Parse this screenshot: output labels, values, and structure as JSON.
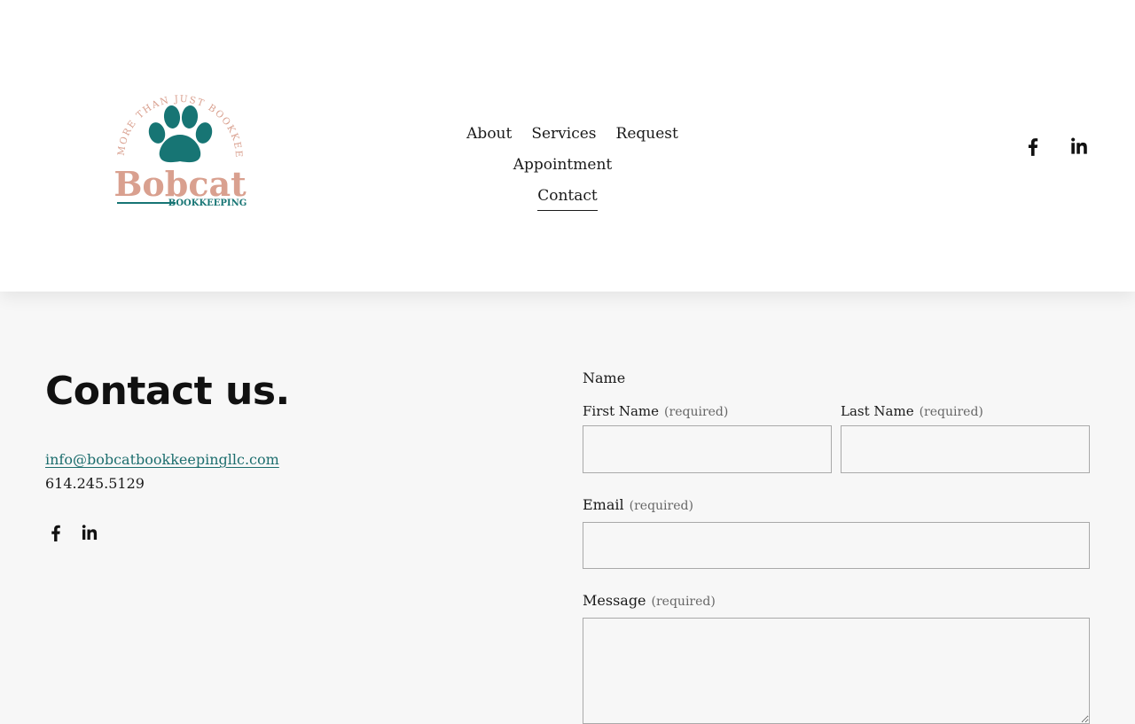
{
  "logo": {
    "arc_text": "MORE THAN JUST BOOKKEEPING",
    "brand": "Bobcat",
    "subtitle": "BOOKKEEPING",
    "paw_color": "#177574",
    "brand_color": "#d9a08f"
  },
  "nav": {
    "items": [
      {
        "label": "About"
      },
      {
        "label": "Services"
      },
      {
        "label": "Request Appointment"
      },
      {
        "label": "Contact",
        "active": true
      }
    ]
  },
  "header_social": [
    "facebook-icon",
    "linkedin-icon"
  ],
  "contact": {
    "title": "Contact us.",
    "email": "info@bobcatbookkeepingllc.com",
    "phone": "614.245.5129",
    "social": [
      "facebook-icon",
      "linkedin-icon"
    ]
  },
  "form": {
    "name_label": "Name",
    "first_name_label": "First Name",
    "last_name_label": "Last Name",
    "email_label": "Email",
    "message_label": "Message",
    "required_text": "(required)",
    "first_name_value": "",
    "last_name_value": "",
    "email_value": "",
    "message_value": ""
  },
  "colors": {
    "accent_link": "#1d6e6e",
    "page_bg": "#f7f7f7",
    "header_bg": "#ffffff"
  }
}
